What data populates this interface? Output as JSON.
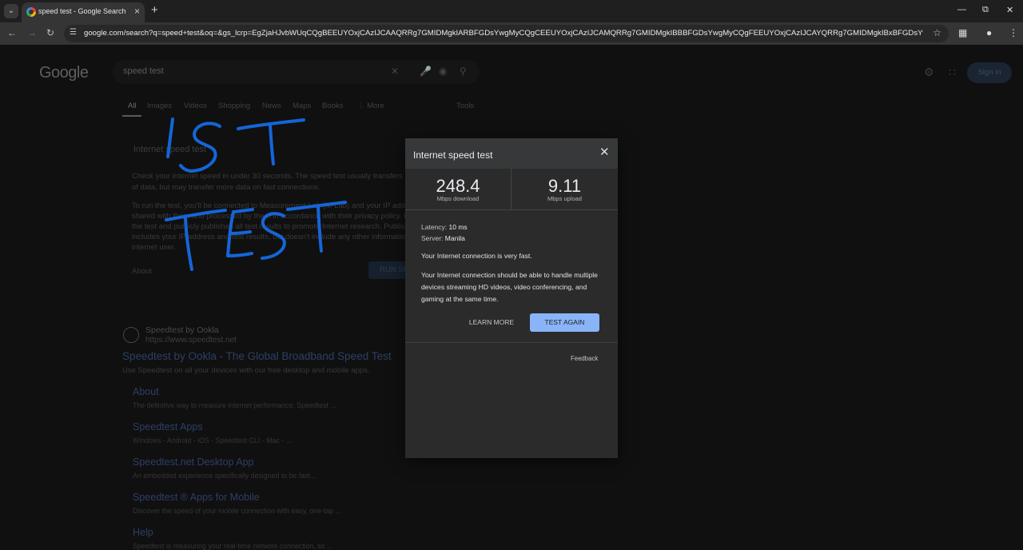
{
  "browser": {
    "tab_title": "speed test - Google Search",
    "url": "google.com/search?q=speed+test&oq=&gs_lcrp=EgZjaHJvbWUqCQgBEEUYOxjCAzIJCAAQRRg7GMIDMgkIARBFGDsYwgMyCQgCEEUYOxjCAzIJCAMQRRg7GMIDMgkIBBBFGDsYwgMyCQgFEEUYOxjCAzIJCAYQRRg7GMIDMgkIBxBFGDsYwgPSAQw2NTE0Nz..."
  },
  "google": {
    "logo": "Google",
    "query": "speed test",
    "sign_in": "Sign in",
    "filters": [
      "All",
      "Images",
      "Videos",
      "Shopping",
      "News",
      "Maps",
      "Books",
      "⋮ More"
    ],
    "tools": "Tools",
    "speed_heading": "Internet speed test",
    "para1_line1": "Check your internet speed in under 30 seconds. The speed test usually transfers less than 40 MB",
    "para1_line2": "of data, but may transfer more data on fast connections.",
    "para2_line1": "To run the test, you'll be connected to Measurement Lab (M-Lab) and your IP address will be",
    "para2_line2": "shared with them and processed by them in accordance with their privacy policy. M-Lab conducts",
    "para2_line3": "the test and publicly publishes all test results to promote Internet research. Published information",
    "para2_line4": "includes your IP address and test results, but doesn't include any other information about you as an",
    "para2_line5": "internet user.",
    "about": "About",
    "run_button": "RUN SPEED TEST",
    "result": {
      "site": "Speedtest by Ookla",
      "url": "https://www.speedtest.net",
      "title": "Speedtest by Ookla - The Global Broadband Speed Test",
      "snippet": "Use Speedtest on all your devices with our free desktop and mobile apps."
    },
    "sitelinks": [
      {
        "title": "About",
        "desc": "The definitive way to measure internet performance. Speedtest ..."
      },
      {
        "title": "Speedtest Apps",
        "desc": "Windows - Android - iOS - Speedtest CLI - Mac - ..."
      },
      {
        "title": "Speedtest.net Desktop App",
        "desc": "An embedded experience specifically designed to be fast..."
      },
      {
        "title": "Speedtest ® Apps for Mobile",
        "desc": "Discover the speed of your mobile connection with easy, one-tap ..."
      },
      {
        "title": "Help",
        "desc": "Speedtest is measuring your real-time network connection, so ..."
      }
    ]
  },
  "dialog": {
    "title": "Internet speed test",
    "download_value": "248.4",
    "download_unit": "Mbps download",
    "upload_value": "9.11",
    "upload_unit": "Mbps upload",
    "latency_label": "Latency:",
    "latency_value": "10 ms",
    "server_label": "Server:",
    "server_value": "Manila",
    "verdict": "Your Internet connection is very fast.",
    "detail": "Your Internet connection should be able to handle multiple devices streaming HD videos, video conferencing, and gaming at the same time.",
    "learn_more": "LEARN MORE",
    "test_again": "TEST AGAIN",
    "feedback": "Feedback"
  },
  "annotation": {
    "color": "#1565d8"
  }
}
